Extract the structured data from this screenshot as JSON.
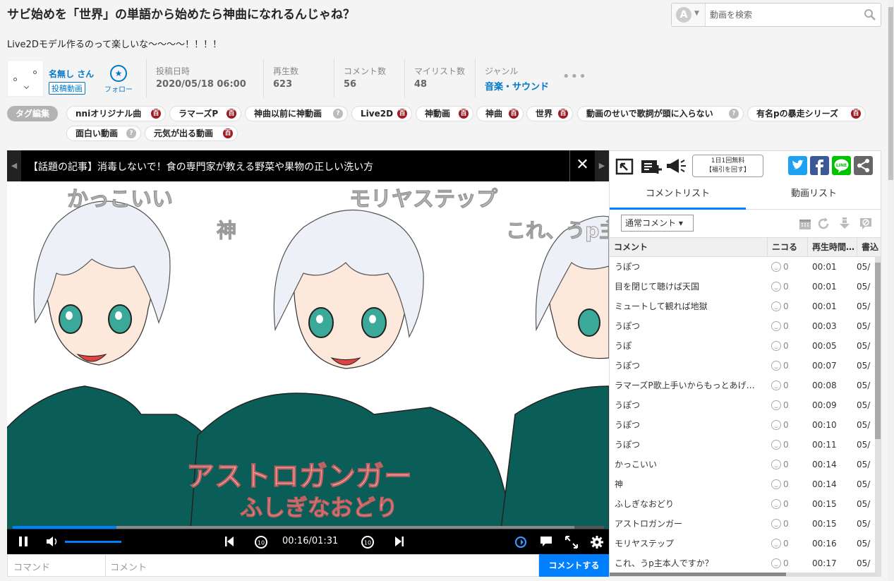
{
  "video": {
    "title": "サビ始めを「世界」の単語から始めたら神曲になれるんじゃね？",
    "description": "Live2Dモデル作るのって楽しいな～～～～！！！！"
  },
  "search": {
    "type_letter": "A",
    "placeholder": "動画を検索"
  },
  "uploader": {
    "name": "名無し さん",
    "videos_label": "投稿動画",
    "follow_label": "フォロー"
  },
  "meta": [
    {
      "key": "投稿日時",
      "value": "2020/05/18 06:00"
    },
    {
      "key": "再生数",
      "value": "623"
    },
    {
      "key": "コメント数",
      "value": "56"
    },
    {
      "key": "マイリスト数",
      "value": "48"
    },
    {
      "key": "ジャンル",
      "value": "音楽・サウンド"
    }
  ],
  "tag_edit_label": "タグ編集",
  "tags": [
    {
      "label": "nniオリジナル曲",
      "dic": true
    },
    {
      "label": "ラマーズP",
      "dic": true
    },
    {
      "label": "神曲以前に神動画",
      "dic": false
    },
    {
      "label": "Live2D",
      "dic": true
    },
    {
      "label": "神動画",
      "dic": true
    },
    {
      "label": "神曲",
      "dic": true
    },
    {
      "label": "世界",
      "dic": true
    },
    {
      "label": "動画のせいで歌詞が頭に入らない",
      "dic": false
    },
    {
      "label": "有名pの暴走シリーズ",
      "dic": true
    },
    {
      "label": "面白い動画",
      "dic": false
    },
    {
      "label": "元気が出る動画",
      "dic": true
    }
  ],
  "badge_dic": "百",
  "badge_nodic": "?",
  "player": {
    "notice": "【話題の記事】消毒しないで！食の専門家が教える野菜や果物の正しい洗い方",
    "overlay_comments": [
      "かっこいい",
      "モリヤステップ",
      "神",
      "これ、うp主",
      "アストロガンガー",
      "ふしぎなおどり"
    ],
    "time": "00:16/01:31",
    "progress": 0.176,
    "buffered": 0.95,
    "volume": 0.5
  },
  "comment_form": {
    "command_placeholder": "コマンド",
    "comment_placeholder": "コメント",
    "submit_label": "コメントする"
  },
  "side": {
    "free_button": [
      "1日1回無料",
      "【福引を回す】"
    ],
    "tabs": [
      "コメントリスト",
      "動画リスト"
    ],
    "filter": "通常コメント ▾",
    "columns": [
      "コメント",
      "ニコる",
      "再生時間…",
      "書込"
    ],
    "comments": [
      {
        "text": "うぽつ",
        "nicoru": "0",
        "time": "00:01",
        "date": "05/"
      },
      {
        "text": "目を閉じて聴けば天国",
        "nicoru": "0",
        "time": "00:01",
        "date": "05/"
      },
      {
        "text": "ミュートして観れば地獄",
        "nicoru": "0",
        "time": "00:01",
        "date": "05/"
      },
      {
        "text": "うぽつ",
        "nicoru": "0",
        "time": "00:03",
        "date": "05/"
      },
      {
        "text": "うぽ",
        "nicoru": "0",
        "time": "00:05",
        "date": "05/"
      },
      {
        "text": "うぽつ",
        "nicoru": "0",
        "time": "00:07",
        "date": "05/"
      },
      {
        "text": "ラマーズP歌上手いからもっとあげ…",
        "nicoru": "0",
        "time": "00:08",
        "date": "05/"
      },
      {
        "text": "うぽつ",
        "nicoru": "0",
        "time": "00:09",
        "date": "05/"
      },
      {
        "text": "うぽつ",
        "nicoru": "0",
        "time": "00:10",
        "date": "05/"
      },
      {
        "text": "うぽつ",
        "nicoru": "0",
        "time": "00:11",
        "date": "05/"
      },
      {
        "text": "かっこいい",
        "nicoru": "0",
        "time": "00:14",
        "date": "05/"
      },
      {
        "text": "神",
        "nicoru": "0",
        "time": "00:14",
        "date": "05/"
      },
      {
        "text": "ふしぎなおどり",
        "nicoru": "0",
        "time": "00:15",
        "date": "05/"
      },
      {
        "text": "アストロガンガー",
        "nicoru": "0",
        "time": "00:15",
        "date": "05/"
      },
      {
        "text": "モリヤステップ",
        "nicoru": "0",
        "time": "00:16",
        "date": "05/"
      },
      {
        "text": "これ、うp主本人ですか？",
        "nicoru": "0",
        "time": "00:17",
        "date": "05/"
      }
    ]
  },
  "colors": {
    "accent": "#0080ff",
    "link": "#0078c8",
    "shirt": "#0b5e58",
    "dic_badge": "#a21a22"
  }
}
